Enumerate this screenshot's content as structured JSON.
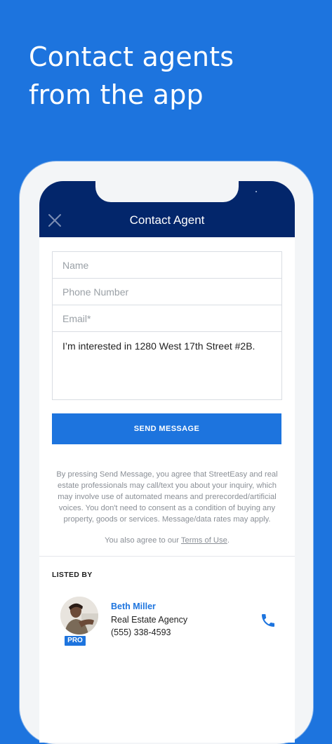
{
  "headline": {
    "line1": "Contact agents",
    "line2": "from the app"
  },
  "nav": {
    "title": "Contact Agent",
    "close_icon": "close-icon"
  },
  "form": {
    "name_placeholder": "Name",
    "phone_placeholder": "Phone Number",
    "email_placeholder": "Email*",
    "message_value": "I’m interested in 1280 West 17th Street #2B."
  },
  "send_button": {
    "label": "SEND MESSAGE"
  },
  "disclaimer": {
    "text": "By pressing Send Message, you agree that StreetEasy and real estate professionals may call/text you about your inquiry, which may involve use of automated means and prerecorded/artificial voices. You don't need to consent as a condition of buying any property, goods or services. Message/data rates may apply.",
    "terms_prefix": "You also agree to our ",
    "terms_link": "Terms of Use",
    "terms_suffix": "."
  },
  "listing": {
    "section_label": "LISTED BY",
    "agent": {
      "name": "Beth Miller",
      "agency": "Real Estate Agency",
      "phone": "(555) 338-4593",
      "badge": "PRO"
    },
    "call_icon": "phone-icon"
  },
  "colors": {
    "background": "#1d74de",
    "nav": "#03266b",
    "accent": "#1d74de"
  }
}
